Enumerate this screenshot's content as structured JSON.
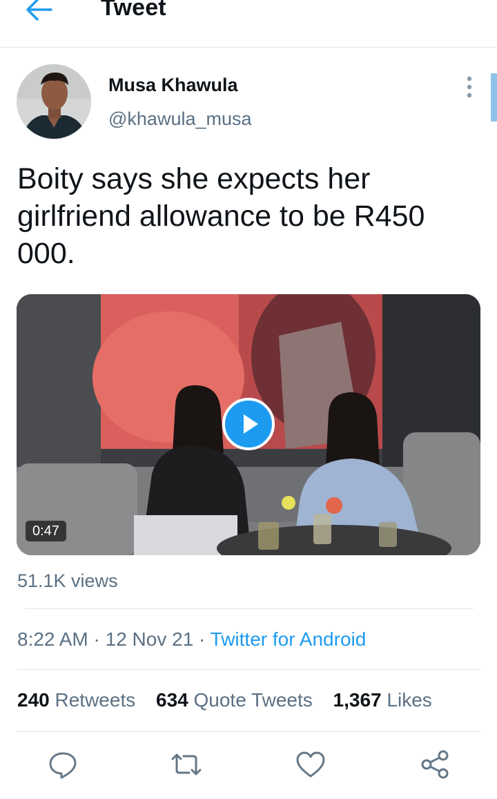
{
  "header": {
    "title": "Tweet",
    "back_icon": "arrow-left-icon"
  },
  "author": {
    "name": "Musa Khawula",
    "handle": "@khawula_musa",
    "avatar": "avatar",
    "more_icon": "more-vertical-icon"
  },
  "tweet": {
    "text": "Boity says she expects her girlfriend allowance to be R450 000."
  },
  "media": {
    "type": "video",
    "duration": "0:47",
    "play_icon": "play-icon"
  },
  "views": "51.1K views",
  "meta": {
    "time": "8:22 AM",
    "separator": "·",
    "date": "12 Nov 21",
    "source": "Twitter for Android"
  },
  "stats": {
    "retweets_count": "240",
    "retweets_label": "Retweets",
    "quotes_count": "634",
    "quotes_label": "Quote Tweets",
    "likes_count": "1,367",
    "likes_label": "Likes"
  },
  "actions": [
    "reply-icon",
    "retweet-icon",
    "like-icon",
    "share-icon"
  ],
  "colors": {
    "accent": "#1d9bf0",
    "secondary_text": "#5b7083",
    "primary_text": "#0f1419",
    "divider": "#e1e8ed"
  }
}
